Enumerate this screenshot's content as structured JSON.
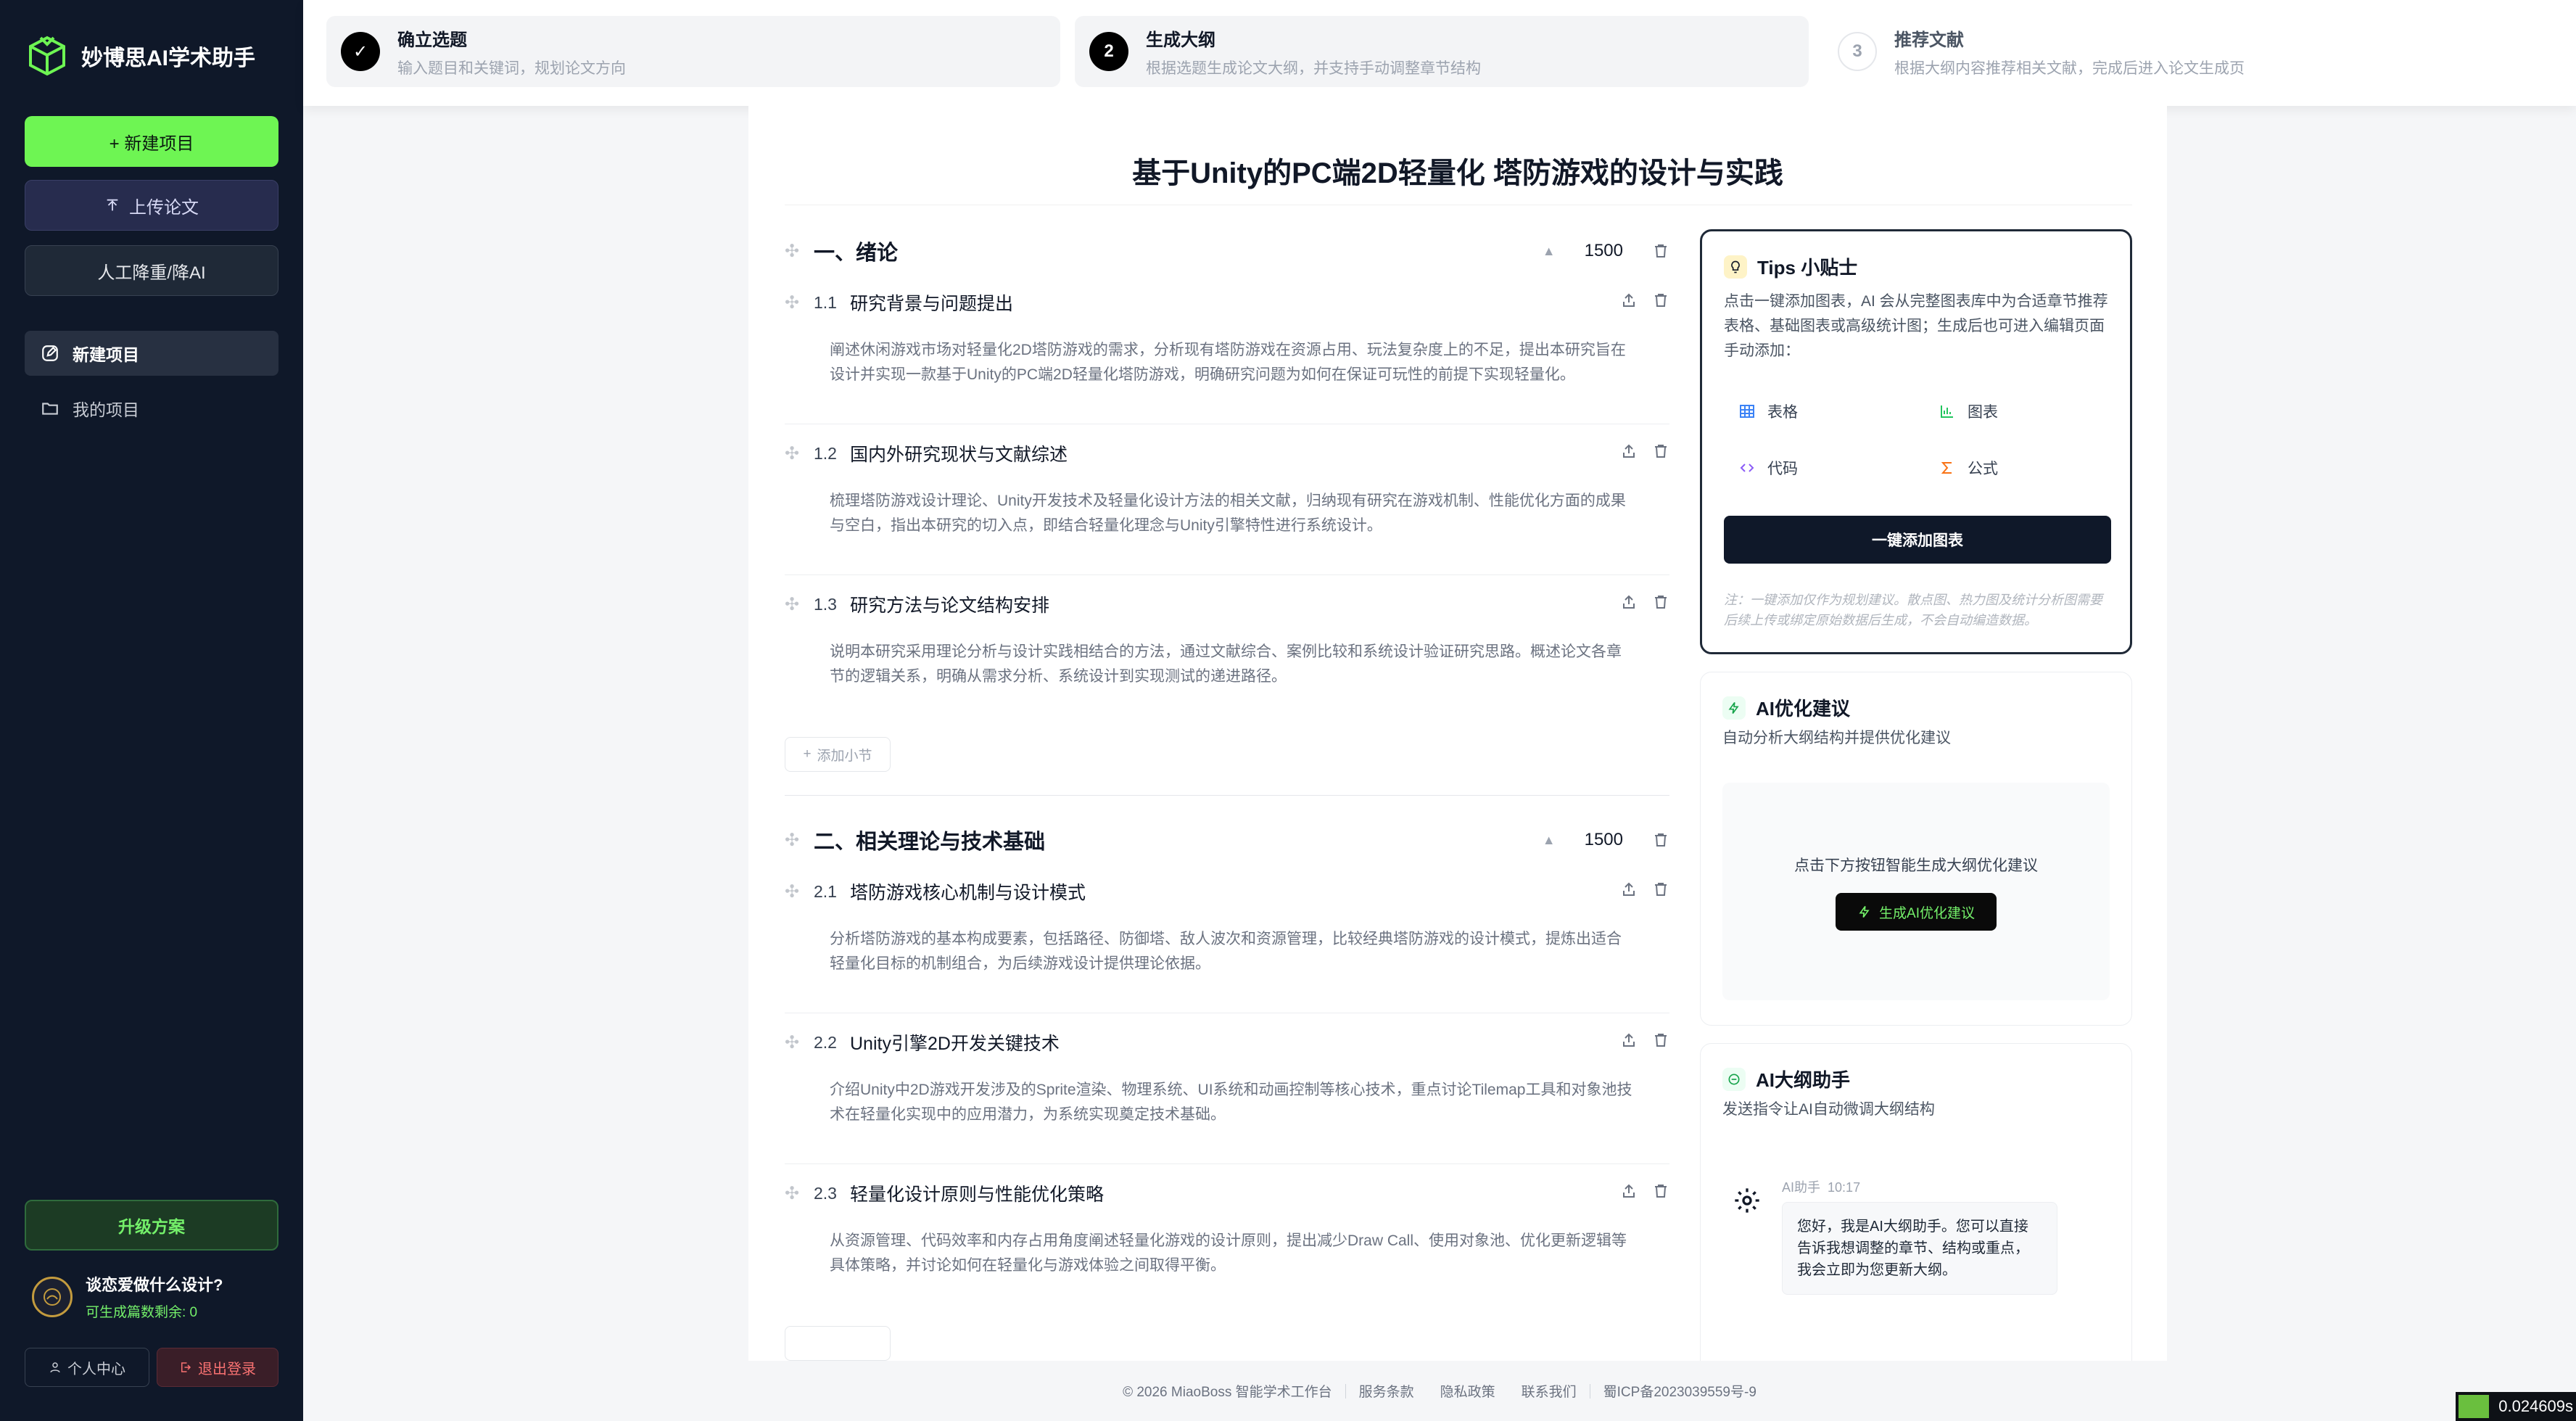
{
  "brand": {
    "name": "妙博思AI学术助手"
  },
  "sidebar": {
    "new_project": "+ 新建项目",
    "upload_paper": "上传论文",
    "ai_reduce": "人工降重/降AI",
    "nav": [
      {
        "label": "新建项目",
        "icon": "edit-icon",
        "active": true
      },
      {
        "label": "我的项目",
        "icon": "folder-icon",
        "active": false
      }
    ],
    "upgrade": "升级方案",
    "user_name": "谈恋爱做什么设计?",
    "user_quota": "可生成篇数剩余: 0",
    "profile": "个人中心",
    "logout": "退出登录"
  },
  "steps": [
    {
      "num": "✓",
      "title": "确立选题",
      "desc": "输入题目和关键词，规划论文方向",
      "state": "done"
    },
    {
      "num": "2",
      "title": "生成大纲",
      "desc": "根据选题生成论文大纲，并支持手动调整章节结构",
      "state": "active"
    },
    {
      "num": "3",
      "title": "推荐文献",
      "desc": "根据大纲内容推荐相关文献，完成后进入论文生成页",
      "state": "pending"
    }
  ],
  "doc_title": "基于Unity的PC端2D轻量化 塔防游戏的设计与实践",
  "outline": {
    "add_sub": "添加小节",
    "chapters": [
      {
        "title": "一、绪论",
        "words": "1500",
        "sections": [
          {
            "num": "1.1",
            "title": "研究背景与问题提出",
            "body": "阐述休闲游戏市场对轻量化2D塔防游戏的需求，分析现有塔防游戏在资源占用、玩法复杂度上的不足，提出本研究旨在设计并实现一款基于Unity的PC端2D轻量化塔防游戏，明确研究问题为如何在保证可玩性的前提下实现轻量化。"
          },
          {
            "num": "1.2",
            "title": "国内外研究现状与文献综述",
            "body": "梳理塔防游戏设计理论、Unity开发技术及轻量化设计方法的相关文献，归纳现有研究在游戏机制、性能优化方面的成果与空白，指出本研究的切入点，即结合轻量化理念与Unity引擎特性进行系统设计。"
          },
          {
            "num": "1.3",
            "title": "研究方法与论文结构安排",
            "body": "说明本研究采用理论分析与设计实践相结合的方法，通过文献综合、案例比较和系统设计验证研究思路。概述论文各章节的逻辑关系，明确从需求分析、系统设计到实现测试的递进路径。"
          }
        ]
      },
      {
        "title": "二、相关理论与技术基础",
        "words": "1500",
        "sections": [
          {
            "num": "2.1",
            "title": "塔防游戏核心机制与设计模式",
            "body": "分析塔防游戏的基本构成要素，包括路径、防御塔、敌人波次和资源管理，比较经典塔防游戏的设计模式，提炼出适合轻量化目标的机制组合，为后续游戏设计提供理论依据。"
          },
          {
            "num": "2.2",
            "title": "Unity引擎2D开发关键技术",
            "body": "介绍Unity中2D游戏开发涉及的Sprite渲染、物理系统、UI系统和动画控制等核心技术，重点讨论Tilemap工具和对象池技术在轻量化实现中的应用潜力，为系统实现奠定技术基础。"
          },
          {
            "num": "2.3",
            "title": "轻量化设计原则与性能优化策略",
            "body": "从资源管理、代码效率和内存占用角度阐述轻量化游戏的设计原则，提出减少Draw Call、使用对象池、优化更新逻辑等具体策略，并讨论如何在轻量化与游戏体验之间取得平衡。"
          }
        ]
      }
    ]
  },
  "tips": {
    "title": "Tips 小贴士",
    "desc": "点击一键添加图表，AI 会从完整图表库中为合适章节推荐表格、基础图表或高级统计图；生成后也可进入编辑页面手动添加：",
    "tools": [
      {
        "label": "表格",
        "icon": "table-icon",
        "color": "#3b82f6"
      },
      {
        "label": "图表",
        "icon": "bar-chart-icon",
        "color": "#22c55e"
      },
      {
        "label": "代码",
        "icon": "code-icon",
        "color": "#8b5cf6"
      },
      {
        "label": "公式",
        "icon": "sigma-icon",
        "color": "#f97316"
      }
    ],
    "button": "一键添加图表",
    "note": "注：一键添加仅作为规划建议。散点图、热力图及统计分析图需要后续上传或绑定原始数据后生成，不会自动编造数据。"
  },
  "ai_optimize": {
    "title": "AI优化建议",
    "desc": "自动分析大纲结构并提供优化建议",
    "prompt": "点击下方按钮智能生成大纲优化建议",
    "button": "生成AI优化建议"
  },
  "ai_chat": {
    "title": "AI大纲助手",
    "desc": "发送指令让AI自动微调大纲结构",
    "sender": "AI助手",
    "time": "10:17",
    "message": "您好，我是AI大纲助手。您可以直接告诉我想调整的章节、结构或重点，我会立即为您更新大纲。"
  },
  "footer": {
    "copyright": "© 2026 MiaoBoss 智能学术工作台",
    "terms": "服务条款",
    "privacy": "隐私政策",
    "contact": "联系我们",
    "icp": "蜀ICP备2023039559号-9"
  },
  "speed": "0.024609s",
  "colors": {
    "accent_green": "#6ef553",
    "sidebar_bg": "#0f1829"
  }
}
